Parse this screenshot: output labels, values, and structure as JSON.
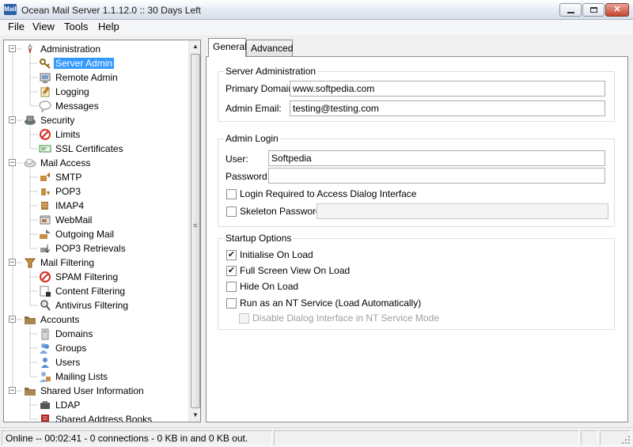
{
  "window": {
    "title": "Ocean Mail Server 1.1.12.0 :: 30 Days Left",
    "app_icon_text": "Mail"
  },
  "menu": {
    "items": [
      "File",
      "View",
      "Tools",
      "Help"
    ]
  },
  "tree": {
    "items": [
      {
        "label": "Administration",
        "icon": "administration-icon"
      },
      {
        "label": "Server Admin",
        "icon": "keys-icon",
        "selected": true
      },
      {
        "label": "Remote Admin",
        "icon": "remote-admin-icon"
      },
      {
        "label": "Logging",
        "icon": "notepad-icon"
      },
      {
        "label": "Messages",
        "icon": "speech-bubble-icon"
      },
      {
        "label": "Security",
        "icon": "security-icon"
      },
      {
        "label": "Limits",
        "icon": "no-entry-icon"
      },
      {
        "label": "SSL Certificates",
        "icon": "certificate-icon"
      },
      {
        "label": "Mail Access",
        "icon": "mail-access-icon"
      },
      {
        "label": "SMTP",
        "icon": "smtp-icon"
      },
      {
        "label": "POP3",
        "icon": "pop3-icon"
      },
      {
        "label": "IMAP4",
        "icon": "imap4-icon"
      },
      {
        "label": "WebMail",
        "icon": "webmail-icon"
      },
      {
        "label": "Outgoing Mail",
        "icon": "outgoing-mail-icon"
      },
      {
        "label": "POP3 Retrievals",
        "icon": "pop3-retrievals-icon"
      },
      {
        "label": "Mail Filtering",
        "icon": "mail-filtering-icon"
      },
      {
        "label": "SPAM Filtering",
        "icon": "no-entry-icon"
      },
      {
        "label": "Content Filtering",
        "icon": "content-filter-icon"
      },
      {
        "label": "Antivirus Filtering",
        "icon": "magnifier-icon"
      },
      {
        "label": "Accounts",
        "icon": "folder-icon"
      },
      {
        "label": "Domains",
        "icon": "domains-icon"
      },
      {
        "label": "Groups",
        "icon": "group-icon"
      },
      {
        "label": "Users",
        "icon": "user-icon"
      },
      {
        "label": "Mailing Lists",
        "icon": "mailing-list-icon"
      },
      {
        "label": "Shared User Information",
        "icon": "folder-icon"
      },
      {
        "label": "LDAP",
        "icon": "ldap-icon"
      },
      {
        "label": "Shared Address Books",
        "icon": "address-book-icon"
      }
    ]
  },
  "tabs": [
    "General",
    "Advanced"
  ],
  "server_admin": {
    "title": "Server Administration",
    "primary_domain_label": "Primary Domain:",
    "primary_domain_value": "www.softpedia.com",
    "admin_email_label": "Admin Email:",
    "admin_email_value": "testing@testing.com"
  },
  "admin_login": {
    "title": "Admin Login",
    "user_label": "User:",
    "user_value": "Softpedia",
    "password_label": "Password:",
    "password_value": "",
    "login_required_label": "Login Required to Access Dialog Interface",
    "login_required_checked": false,
    "skeleton_password_label": "Skeleton Password:",
    "skeleton_password_checked": false,
    "skeleton_password_value": ""
  },
  "startup": {
    "title": "Startup Options",
    "options": [
      {
        "label": "Initialise On Load",
        "checked": true,
        "disabled": false
      },
      {
        "label": "Full Screen View On Load",
        "checked": true,
        "disabled": false
      },
      {
        "label": "Hide On Load",
        "checked": false,
        "disabled": false
      },
      {
        "label": "Run as an NT Service (Load Automatically)",
        "checked": false,
        "disabled": false
      },
      {
        "label": "Disable Dialog Interface in NT Service Mode",
        "checked": false,
        "disabled": true
      }
    ]
  },
  "status": {
    "text": "Online -- 00:02:41 - 0 connections - 0 KB in and 0 KB out."
  },
  "colors": {
    "selection": "#3399ff",
    "page_bg": "#f0f0f0",
    "border": "#898c95"
  }
}
